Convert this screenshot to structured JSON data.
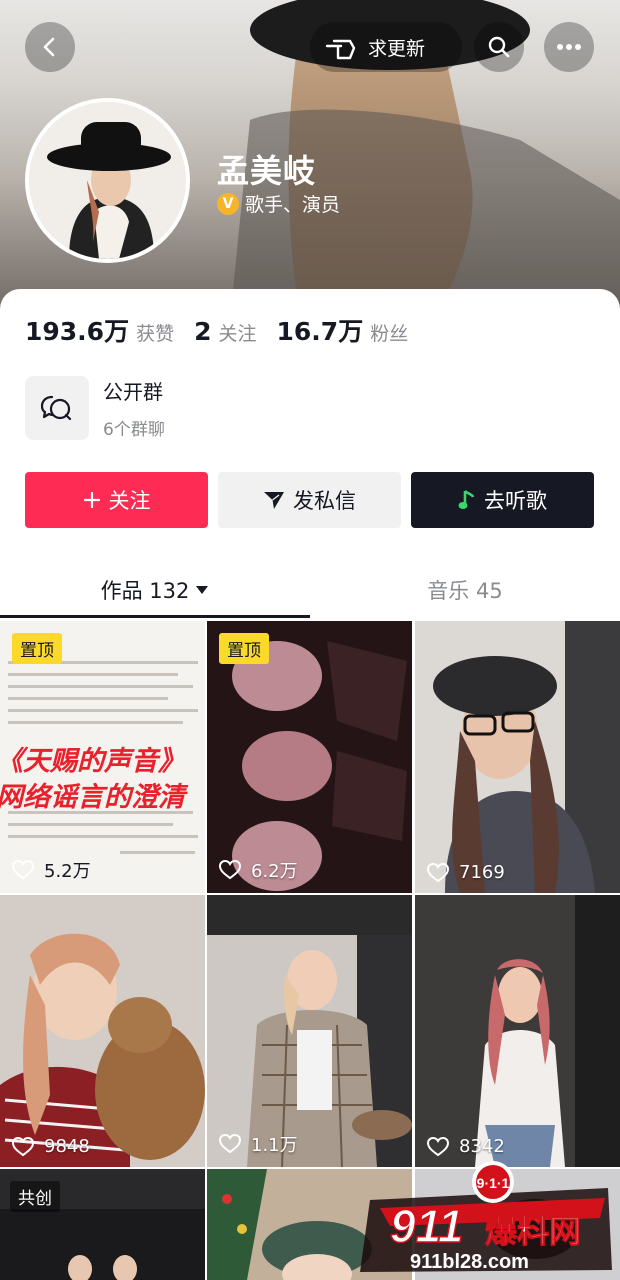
{
  "header": {
    "update_button_label": "求更新",
    "icons": {
      "back": "back-chevron-icon",
      "search": "search-icon",
      "more": "more-dots-icon",
      "update": "hand-point-icon"
    }
  },
  "profile": {
    "name": "孟美岐",
    "verified_badge": "V",
    "verification_text": "歌手、演员"
  },
  "stats": [
    {
      "num": "193.6万",
      "label": "获赞"
    },
    {
      "num": "2",
      "label": "关注"
    },
    {
      "num": "16.7万",
      "label": "粉丝"
    }
  ],
  "group": {
    "title": "公开群",
    "subtitle": "6个群聊",
    "icon": "chat-bubbles-icon"
  },
  "actions": {
    "follow": "关注",
    "message": "发私信",
    "music": "去听歌"
  },
  "tabs": {
    "works_label": "作品 132",
    "music_label": "音乐 45"
  },
  "posts": [
    {
      "badge": "置顶",
      "likes": "5.2万"
    },
    {
      "badge": "置顶",
      "likes": "6.2万"
    },
    {
      "badge": "",
      "likes": "7169"
    },
    {
      "badge": "",
      "likes": "9848"
    },
    {
      "badge": "",
      "likes": "1.1万"
    },
    {
      "badge": "",
      "likes": "8342"
    },
    {
      "badge": "共创",
      "likes": ""
    },
    {
      "badge": "",
      "likes": ""
    },
    {
      "badge": "",
      "likes": ""
    }
  ],
  "post1_text": {
    "line1": "《天赐的声音》",
    "line2": "网络谣言的澄清"
  },
  "watermark": {
    "number": "911",
    "brand": "爆料网",
    "url": "911bl28.com",
    "emblem": "9·1·1"
  },
  "colors": {
    "follow": "#fe2c55",
    "dark": "#161823",
    "pin": "#fbd92b",
    "badge": "#f5b42a"
  }
}
